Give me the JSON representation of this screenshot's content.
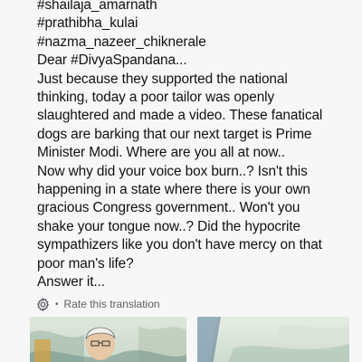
{
  "post": {
    "lines": [
      "#shailaja_amarnath",
      "#prathibha_kulai",
      "#nazma_nazeer_chiknerale",
      "Dear #DivyaSpandana...",
      "Just because they supported the national",
      "thinking, today a poor tailor was openly",
      "slaughtered and made a video. These fanatical",
      "dogs are barking that our next target is Prime",
      "Minister Modi. Where are you all at now..",
      "Now why did your voice box burn..? Isn't this",
      "happening in a state where there is your own",
      "gracious Congress government.. Won't you",
      "shake your tongue now..? Did the hypocrite",
      "sympathizers like you don't have mercy on that",
      "poor man's life?",
      "Answer it..."
    ]
  },
  "translation": {
    "separator": "•",
    "rate_label": "Rate this translation",
    "icon": "gear-icon"
  },
  "images": {
    "icon": "photo-thumbnail"
  },
  "colors": {
    "background": "#f7f7f7",
    "text": "#111111",
    "secondary_text": "#5b5e63"
  }
}
